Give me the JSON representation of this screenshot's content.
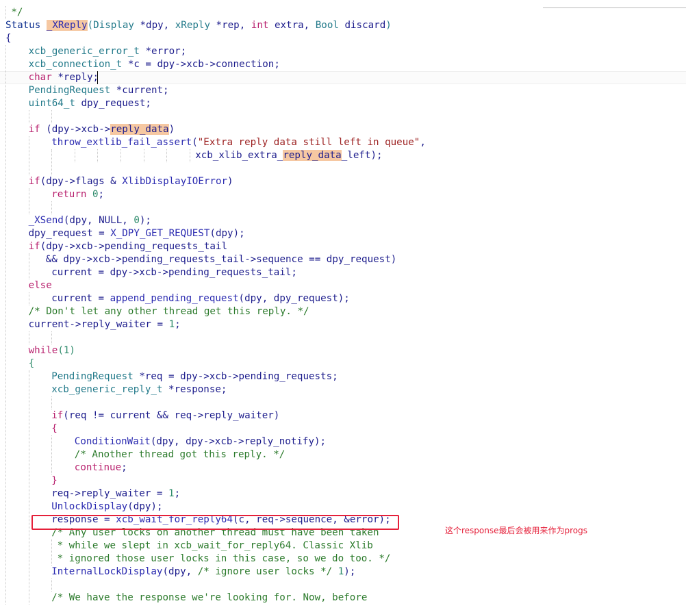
{
  "colors": {
    "default": "#1c1c8c",
    "type": "#237a8a",
    "keyword": "#b8216e",
    "func": "#2a2ab0",
    "string": "#9c2020",
    "number": "#2c8a6a",
    "comment": "#2b7a2b",
    "status": "#0d2f8f",
    "highlight": "#f6c8a2",
    "annotation": "#e5203a"
  },
  "annotation": {
    "text": "这个response最后会被用来作为progs"
  },
  "code": {
    "lines": [
      {
        "indent": 1,
        "segs": [
          [
            "*/",
            "comment"
          ]
        ]
      },
      {
        "indent": 0,
        "segs": [
          [
            "Status ",
            "status"
          ],
          [
            "_XReply",
            "func",
            true
          ],
          [
            "(",
            "type"
          ],
          [
            "Display ",
            "type"
          ],
          [
            "*dpy, ",
            "default"
          ],
          [
            "xReply ",
            "type"
          ],
          [
            "*rep, ",
            "default"
          ],
          [
            "int ",
            "keyword"
          ],
          [
            "extra, ",
            "default"
          ],
          [
            "Bool ",
            "type"
          ],
          [
            "discard",
            "default"
          ],
          [
            ")",
            "type"
          ]
        ]
      },
      {
        "indent": 0,
        "segs": [
          [
            "{",
            "default"
          ]
        ]
      },
      {
        "indent": 4,
        "segs": [
          [
            "xcb_generic_error_t ",
            "type"
          ],
          [
            "*error;",
            "default"
          ]
        ]
      },
      {
        "indent": 4,
        "segs": [
          [
            "xcb_connection_t ",
            "type"
          ],
          [
            "*c = dpy->xcb->connection;",
            "default"
          ]
        ]
      },
      {
        "indent": 4,
        "segs": [
          [
            "char ",
            "keyword"
          ],
          [
            "*reply;",
            "default"
          ]
        ]
      },
      {
        "indent": 4,
        "segs": [
          [
            "PendingRequest ",
            "type"
          ],
          [
            "*current;",
            "default"
          ]
        ]
      },
      {
        "indent": 4,
        "segs": [
          [
            "uint64_t ",
            "type"
          ],
          [
            "dpy_request;",
            "default"
          ]
        ]
      },
      {
        "indent": 0,
        "segs": []
      },
      {
        "indent": 4,
        "segs": [
          [
            "if ",
            "keyword"
          ],
          [
            "(dpy->xcb->",
            "default"
          ],
          [
            "reply_data",
            "default",
            true
          ],
          [
            ")",
            "default"
          ]
        ]
      },
      {
        "indent": 8,
        "segs": [
          [
            "throw_extlib_fail_assert",
            "func"
          ],
          [
            "(",
            "default"
          ],
          [
            "\"Extra reply data still left in queue\"",
            "string"
          ],
          [
            ",",
            "default"
          ]
        ]
      },
      {
        "indent": 33,
        "segs": [
          [
            "xcb_xlib_extra_",
            "default"
          ],
          [
            "reply_data",
            "default",
            true
          ],
          [
            "_left);",
            "default"
          ]
        ]
      },
      {
        "indent": 0,
        "segs": []
      },
      {
        "indent": 4,
        "segs": [
          [
            "if",
            "keyword"
          ],
          [
            "(dpy->flags & ",
            "default"
          ],
          [
            "XlibDisplayIOError",
            "func"
          ],
          [
            ")",
            "default"
          ]
        ]
      },
      {
        "indent": 8,
        "segs": [
          [
            "return ",
            "keyword"
          ],
          [
            "0",
            "number"
          ],
          [
            ";",
            "default"
          ]
        ]
      },
      {
        "indent": 0,
        "segs": []
      },
      {
        "indent": 4,
        "segs": [
          [
            "_XSend",
            "func"
          ],
          [
            "(dpy, NULL, ",
            "default"
          ],
          [
            "0",
            "number"
          ],
          [
            ");",
            "default"
          ]
        ]
      },
      {
        "indent": 4,
        "segs": [
          [
            "dpy_request = ",
            "default"
          ],
          [
            "X_DPY_GET_REQUEST",
            "func"
          ],
          [
            "(dpy);",
            "default"
          ]
        ]
      },
      {
        "indent": 4,
        "segs": [
          [
            "if",
            "keyword"
          ],
          [
            "(dpy->xcb->pending_requests_tail",
            "default"
          ]
        ]
      },
      {
        "indent": 7,
        "segs": [
          [
            "&& dpy->xcb->pending_requests_tail->sequence == dpy_request)",
            "default"
          ]
        ]
      },
      {
        "indent": 8,
        "segs": [
          [
            "current = dpy->xcb->pending_requests_tail;",
            "default"
          ]
        ]
      },
      {
        "indent": 4,
        "segs": [
          [
            "else",
            "keyword"
          ]
        ]
      },
      {
        "indent": 8,
        "segs": [
          [
            "current = ",
            "default"
          ],
          [
            "append_pending_request",
            "func"
          ],
          [
            "(dpy, dpy_request);",
            "default"
          ]
        ]
      },
      {
        "indent": 4,
        "segs": [
          [
            "/* Don't let any other thread get this reply. */",
            "comment"
          ]
        ]
      },
      {
        "indent": 4,
        "segs": [
          [
            "current->reply_waiter = ",
            "default"
          ],
          [
            "1",
            "number"
          ],
          [
            ";",
            "default"
          ]
        ]
      },
      {
        "indent": 0,
        "segs": []
      },
      {
        "indent": 4,
        "segs": [
          [
            "while",
            "keyword"
          ],
          [
            "(1)",
            "number"
          ]
        ]
      },
      {
        "indent": 4,
        "segs": [
          [
            "{",
            "number"
          ]
        ]
      },
      {
        "indent": 8,
        "segs": [
          [
            "PendingRequest ",
            "type"
          ],
          [
            "*req = dpy->xcb->pending_requests;",
            "default"
          ]
        ]
      },
      {
        "indent": 8,
        "segs": [
          [
            "xcb_generic_reply_t ",
            "type"
          ],
          [
            "*response;",
            "default"
          ]
        ]
      },
      {
        "indent": 0,
        "segs": []
      },
      {
        "indent": 8,
        "segs": [
          [
            "if",
            "keyword"
          ],
          [
            "(req != current && req->reply_waiter)",
            "default"
          ]
        ]
      },
      {
        "indent": 8,
        "segs": [
          [
            "{",
            "keyword"
          ]
        ]
      },
      {
        "indent": 12,
        "segs": [
          [
            "ConditionWait",
            "func"
          ],
          [
            "(dpy, dpy->xcb->reply_notify);",
            "default"
          ]
        ]
      },
      {
        "indent": 12,
        "segs": [
          [
            "/* Another thread got this reply. */",
            "comment"
          ]
        ]
      },
      {
        "indent": 12,
        "segs": [
          [
            "continue",
            "keyword"
          ],
          [
            ";",
            "default"
          ]
        ]
      },
      {
        "indent": 8,
        "segs": [
          [
            "}",
            "keyword"
          ]
        ]
      },
      {
        "indent": 8,
        "segs": [
          [
            "req->reply_waiter = ",
            "default"
          ],
          [
            "1",
            "number"
          ],
          [
            ";",
            "default"
          ]
        ]
      },
      {
        "indent": 8,
        "segs": [
          [
            "UnlockDisplay",
            "func"
          ],
          [
            "(dpy);",
            "default"
          ]
        ]
      },
      {
        "indent": 8,
        "segs": [
          [
            "response = ",
            "default"
          ],
          [
            "xcb_wait_for_reply64",
            "func"
          ],
          [
            "(c, req->sequence, &error);",
            "default"
          ]
        ]
      },
      {
        "indent": 8,
        "segs": [
          [
            "/* Any user locks on another thread must have been taken",
            "comment"
          ]
        ]
      },
      {
        "indent": 9,
        "segs": [
          [
            "* while we slept in xcb_wait_for_reply64. Classic Xlib",
            "comment"
          ]
        ]
      },
      {
        "indent": 9,
        "segs": [
          [
            "* ignored those user locks in this case, so we do too. */",
            "comment"
          ]
        ]
      },
      {
        "indent": 8,
        "segs": [
          [
            "InternalLockDisplay",
            "func"
          ],
          [
            "(dpy, ",
            "default"
          ],
          [
            "/* ignore user locks */ ",
            "comment"
          ],
          [
            "1",
            "number"
          ],
          [
            ");",
            "default"
          ]
        ]
      },
      {
        "indent": 0,
        "segs": []
      },
      {
        "indent": 8,
        "segs": [
          [
            "/* We have the response we're looking for. Now, before",
            "comment"
          ]
        ]
      }
    ]
  }
}
